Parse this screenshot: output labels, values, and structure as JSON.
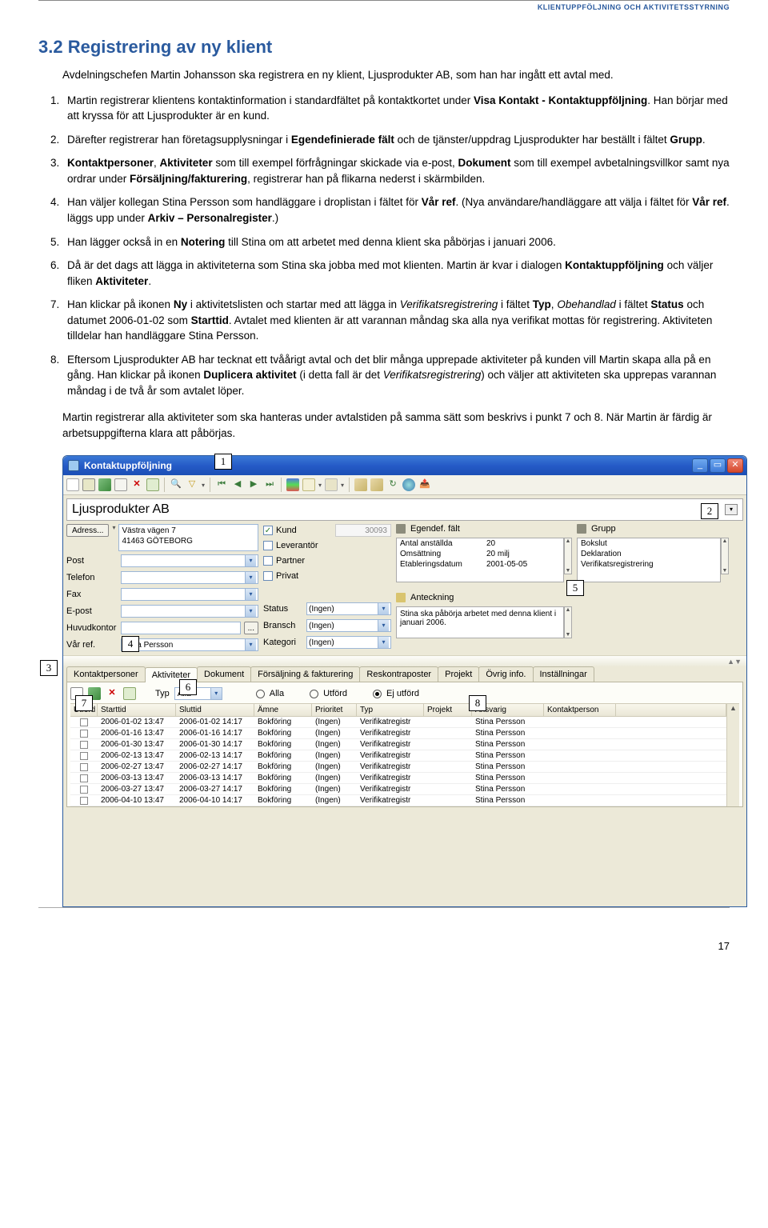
{
  "page_header": "KLIENTUPPFÖLJNING OCH AKTIVITETSSTYRNING",
  "section_heading": "3.2 Registrering av ny klient",
  "intro": "Avdelningschefen Martin Johansson ska registrera en ny klient, Ljusprodukter AB, som han har ingått ett avtal med.",
  "steps": [
    "Martin registrerar klientens kontaktinformation i standardfältet på kontaktkortet under Visa Kontakt - Kontaktuppföljning. Han börjar med att kryssa för att Ljusprodukter är en kund.",
    "Därefter registrerar han företagsupplysningar i Egendefinierade fält och de tjänster/uppdrag Ljusprodukter har beställt i fältet Grupp.",
    "Kontaktpersoner, Aktiviteter som till exempel förfrågningar skickade via e-post, Dokument som till exempel avbetalningsvillkor samt nya ordrar under Försäljning/fakturering, registrerar han på flikarna nederst i skärmbilden.",
    "Han väljer kollegan Stina Persson som handläggare i droplistan i fältet för Vår ref. (Nya användare/handläggare att välja i fältet för Vår ref. läggs upp under Arkiv – Personalregister.)",
    "Han lägger också in en Notering till Stina om att arbetet med denna klient ska påbörjas i januari 2006.",
    "Då är det dags att lägga in aktiviteterna som Stina ska jobba med mot klienten. Martin är kvar i dialogen Kontaktuppföljning och väljer fliken Aktiviteter.",
    "Han klickar på ikonen Ny i aktivitetslisten och startar med att lägga in Verifikatsregistrering i fältet Typ, Obehandlad i fältet Status och datumet 2006-01-02 som Starttid. Avtalet med klienten är att varannan måndag ska alla nya verifikat mottas för registrering. Aktiviteten tilldelar han handläggare Stina Persson.",
    "Eftersom Ljusprodukter AB har tecknat ett tvåårigt avtal och det blir många upprepade aktiviteter på kunden vill Martin skapa alla på en gång. Han klickar på ikonen Duplicera aktivitet (i detta fall är det Verifikatsregistrering) och väljer att aktiviteten ska upprepas varannan måndag i de två år som avtalet löper."
  ],
  "after": "Martin registrerar alla aktiviteter som ska hanteras under avtalstiden på samma sätt som beskrivs i punkt 7 och 8. När Martin är färdig är arbetsuppgifterna klara att påbörjas.",
  "callouts": [
    "1",
    "2",
    "3",
    "4",
    "5",
    "6",
    "7",
    "8"
  ],
  "window": {
    "title": "Kontaktuppföljning",
    "company": "Ljusprodukter AB",
    "left": {
      "address_btn": "Adress...",
      "address_lines": "Västra vägen 7\n41463 GÖTEBORG",
      "labels": {
        "post": "Post",
        "telefon": "Telefon",
        "fax": "Fax",
        "epost": "E-post",
        "huvudkontor": "Huvudkontor",
        "var_ref": "Vår ref."
      },
      "huvudkontor_btn": "...",
      "var_ref_value": "Stina Persson"
    },
    "middle": {
      "kund": "Kund",
      "leverantor": "Leverantör",
      "partner": "Partner",
      "privat": "Privat",
      "numbox": "30093",
      "status_lbl": "Status",
      "bransch_lbl": "Bransch",
      "kategori_lbl": "Kategori",
      "ingen": "(Ingen)"
    },
    "right": {
      "egendef_header": "Egendef. fält",
      "grupp_header": "Grupp",
      "egendef": [
        {
          "k": "Antal anställda",
          "v": "20"
        },
        {
          "k": "Omsättning",
          "v": "20 milj"
        },
        {
          "k": "Etableringsdatum",
          "v": "2001-05-05"
        }
      ],
      "grupp": [
        "Bokslut",
        "Deklaration",
        "Verifikatsregistrering"
      ],
      "anteckning_header": "Anteckning",
      "anteckning_text": "Stina ska påbörja arbetet med denna klient i januari 2006."
    },
    "tabs": {
      "items": [
        "Kontaktpersoner",
        "Aktiviteter",
        "Dokument",
        "Försäljning & fakturering",
        "Reskontraposter",
        "Projekt",
        "Övrig info.",
        "Inställningar"
      ],
      "active": "Aktiviteter"
    },
    "sub": {
      "typ_lbl": "Typ",
      "typ_val": "Alla",
      "radio_alla": "Alla",
      "radio_utford": "Utförd",
      "radio_ej": "Ej utförd"
    },
    "grid": {
      "headers": [
        "Utförd",
        "Starttid",
        "Sluttid",
        "Ämne",
        "Prioritet",
        "Typ",
        "Projekt",
        "Ansvarig",
        "Kontaktperson",
        ""
      ],
      "rows": [
        {
          "start": "2006-01-02 13:47",
          "slut": "2006-01-02 14:17",
          "amne": "Bokföring",
          "prio": "(Ingen)",
          "typ": "Verifikatregistr",
          "proj": "",
          "ansv": "Stina Persson",
          "kont": ""
        },
        {
          "start": "2006-01-16 13:47",
          "slut": "2006-01-16 14:17",
          "amne": "Bokföring",
          "prio": "(Ingen)",
          "typ": "Verifikatregistr",
          "proj": "",
          "ansv": "Stina Persson",
          "kont": ""
        },
        {
          "start": "2006-01-30 13:47",
          "slut": "2006-01-30 14:17",
          "amne": "Bokföring",
          "prio": "(Ingen)",
          "typ": "Verifikatregistr",
          "proj": "",
          "ansv": "Stina Persson",
          "kont": ""
        },
        {
          "start": "2006-02-13 13:47",
          "slut": "2006-02-13 14:17",
          "amne": "Bokföring",
          "prio": "(Ingen)",
          "typ": "Verifikatregistr",
          "proj": "",
          "ansv": "Stina Persson",
          "kont": ""
        },
        {
          "start": "2006-02-27 13:47",
          "slut": "2006-02-27 14:17",
          "amne": "Bokföring",
          "prio": "(Ingen)",
          "typ": "Verifikatregistr",
          "proj": "",
          "ansv": "Stina Persson",
          "kont": ""
        },
        {
          "start": "2006-03-13 13:47",
          "slut": "2006-03-13 14:17",
          "amne": "Bokföring",
          "prio": "(Ingen)",
          "typ": "Verifikatregistr",
          "proj": "",
          "ansv": "Stina Persson",
          "kont": ""
        },
        {
          "start": "2006-03-27 13:47",
          "slut": "2006-03-27 14:17",
          "amne": "Bokföring",
          "prio": "(Ingen)",
          "typ": "Verifikatregistr",
          "proj": "",
          "ansv": "Stina Persson",
          "kont": ""
        },
        {
          "start": "2006-04-10 13:47",
          "slut": "2006-04-10 14:17",
          "amne": "Bokföring",
          "prio": "(Ingen)",
          "typ": "Verifikatregistr",
          "proj": "",
          "ansv": "Stina Persson",
          "kont": ""
        }
      ]
    }
  },
  "page_number": "17"
}
